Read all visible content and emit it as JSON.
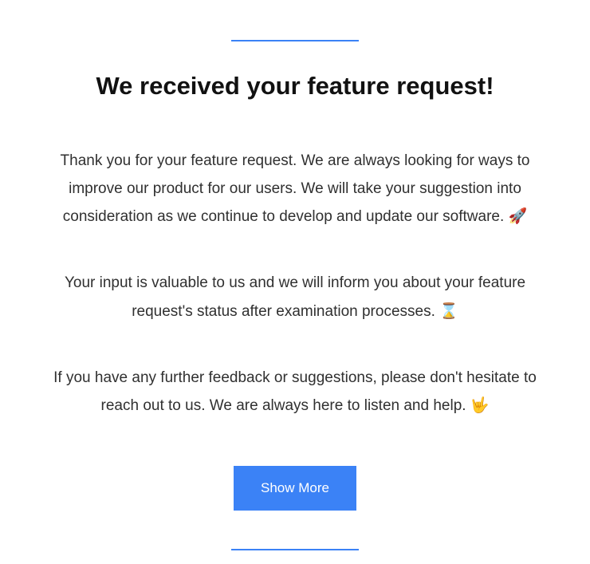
{
  "title": "We received your feature request!",
  "paragraphs": {
    "p1": "Thank you for your feature request. We are always looking for ways to improve our product for our users. We will take your suggestion into consideration as we continue to develop and update our software. 🚀",
    "p2": "Your input is valuable to us and we will inform you about your feature request's status after examination processes. ⌛",
    "p3": "If you have any further feedback or suggestions, please don't hesitate to reach out to us. We are always here to listen and help. 🤟"
  },
  "button": {
    "label": "Show More"
  }
}
